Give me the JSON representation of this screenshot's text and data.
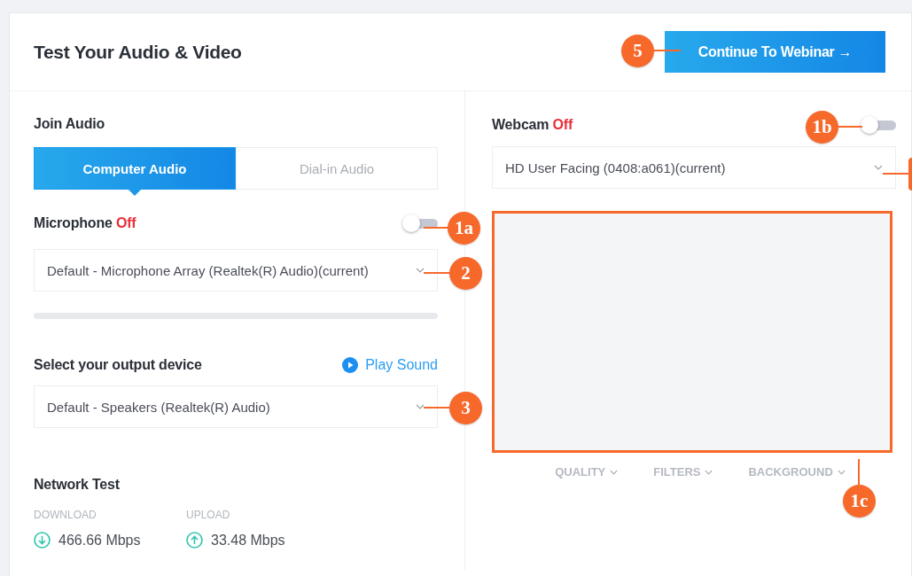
{
  "header": {
    "title": "Test Your Audio & Video",
    "continue_button": "Continue To Webinar →"
  },
  "audio": {
    "heading": "Join Audio",
    "tabs": [
      {
        "label": "Computer Audio",
        "selected": true
      },
      {
        "label": "Dial-in Audio",
        "selected": false
      }
    ],
    "microphone": {
      "label": "Microphone",
      "state_text": "Off",
      "on": false,
      "device": "Default - Microphone Array (Realtek(R) Audio)(current)",
      "level": 0
    },
    "output": {
      "label": "Select your output device",
      "play_sound": "Play Sound",
      "device": "Default - Speakers (Realtek(R) Audio)"
    },
    "network": {
      "heading": "Network Test",
      "stats": [
        {
          "kind": "download",
          "label": "DOWNLOAD",
          "value": "466.66 Mbps"
        },
        {
          "kind": "upload",
          "label": "UPLOAD",
          "value": "33.48 Mbps"
        }
      ]
    }
  },
  "video": {
    "label": "Webcam",
    "state_text": "Off",
    "on": false,
    "device": "HD User Facing (0408:a061)(current)",
    "highlighted": true,
    "options": [
      "QUALITY",
      "FILTERS",
      "BACKGROUND"
    ]
  },
  "callouts": [
    {
      "kind": "numbered",
      "label": "5"
    },
    {
      "kind": "numbered",
      "label": "1b"
    },
    {
      "kind": "cut"
    },
    {
      "kind": "numbered",
      "label": "1a"
    },
    {
      "kind": "numbered",
      "label": "2"
    },
    {
      "kind": "numbered",
      "label": "3"
    },
    {
      "kind": "numbered",
      "label": "1c"
    }
  ]
}
